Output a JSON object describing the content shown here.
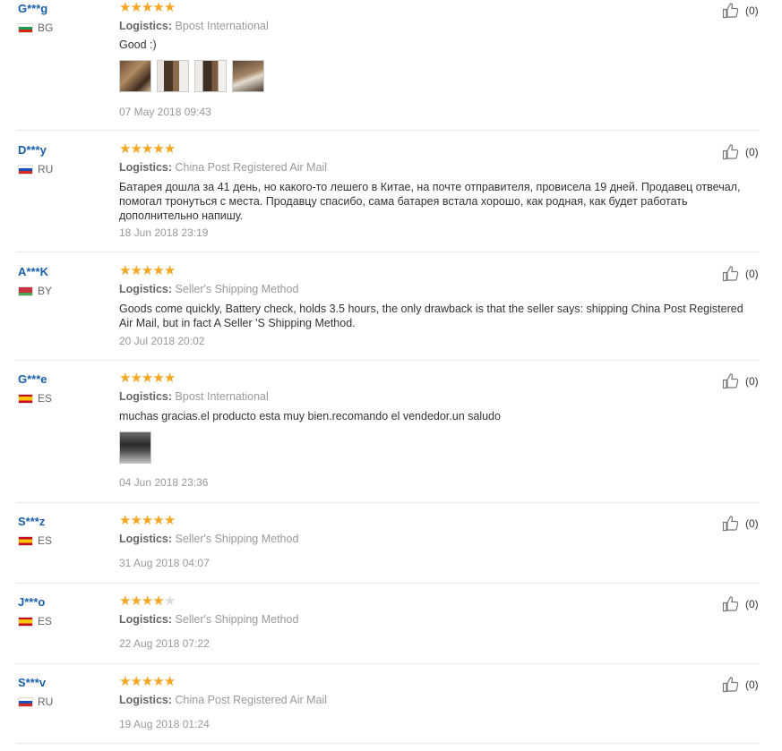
{
  "colors": {
    "accent_star": "#f5a623",
    "username": "#1a5fa8",
    "muted": "#999999"
  },
  "icons": {
    "like": "thumbs-up-icon",
    "star": "star-icon"
  },
  "logistics_label": "Logistics:",
  "reviews": [
    {
      "user": "G***g",
      "country": "BG",
      "rating": 5,
      "logistics": "Bpost International",
      "text": "Good :)",
      "photo_count": 4,
      "date": "07 May 2018 09:43",
      "likes": "(0)"
    },
    {
      "user": "D***y",
      "country": "RU",
      "rating": 5,
      "logistics": "China Post Registered Air Mail",
      "text": "Батарея дошла за 41 день, но какого-то лешего в Китае, на почте отправителя, провисела 19 дней. Продавец отвечал, помогал тронуться с места. Продавцу спасибо, сама батарея встала хорошо, как родная, как будет работать дополнительно напишу.",
      "photo_count": 0,
      "date": "18 Jun 2018 23:19",
      "likes": "(0)"
    },
    {
      "user": "A***K",
      "country": "BY",
      "rating": 5,
      "logistics": "Seller's Shipping Method",
      "text": "Goods come quickly, Battery check, holds 3.5 hours, the only drawback is that the seller says: shipping China Post Registered Air Mail, but in fact A Seller 'S Shipping Method.",
      "photo_count": 0,
      "date": "20 Jul 2018 20:02",
      "likes": "(0)"
    },
    {
      "user": "G***e",
      "country": "ES",
      "rating": 5,
      "logistics": "Bpost International",
      "text": "muchas gracias.el producto esta muy bien.recomando el vendedor.un saludo",
      "photo_count": 1,
      "date": "04 Jun 2018 23:36",
      "likes": "(0)"
    },
    {
      "user": "S***z",
      "country": "ES",
      "rating": 5,
      "logistics": "Seller's Shipping Method",
      "text": "",
      "photo_count": 0,
      "date": "31 Aug 2018 04:07",
      "likes": "(0)"
    },
    {
      "user": "J***o",
      "country": "ES",
      "rating": 4,
      "logistics": "Seller's Shipping Method",
      "text": "",
      "photo_count": 0,
      "date": "22 Aug 2018 07:22",
      "likes": "(0)"
    },
    {
      "user": "S***v",
      "country": "RU",
      "rating": 5,
      "logistics": "China Post Registered Air Mail",
      "text": "",
      "photo_count": 0,
      "date": "19 Aug 2018 01:24",
      "likes": "(0)"
    }
  ]
}
